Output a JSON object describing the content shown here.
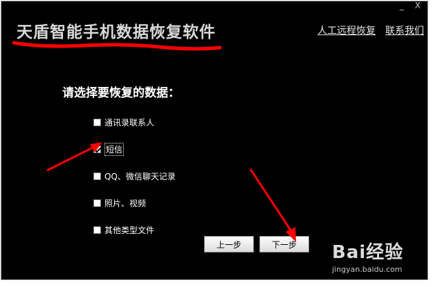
{
  "window": {
    "minimize_label": "_",
    "close_label": "X"
  },
  "header": {
    "title": "天盾智能手机数据恢复软件",
    "links": [
      "人工远程恢复",
      "联系我们"
    ]
  },
  "main": {
    "prompt": "请选择要恢复的数据：",
    "options": [
      {
        "label": "通讯录联系人",
        "checked": false
      },
      {
        "label": "短信",
        "checked": true
      },
      {
        "label": "QQ、微信聊天记录",
        "checked": false
      },
      {
        "label": "照片、视频",
        "checked": false
      },
      {
        "label": "其他类型文件",
        "checked": false
      }
    ]
  },
  "footer": {
    "prev_label": "上一步",
    "next_label": "下一步"
  },
  "watermark": {
    "brand": "Bai经验",
    "url": "jingyan.baidu.com"
  },
  "annotation_color": "#ff0000"
}
